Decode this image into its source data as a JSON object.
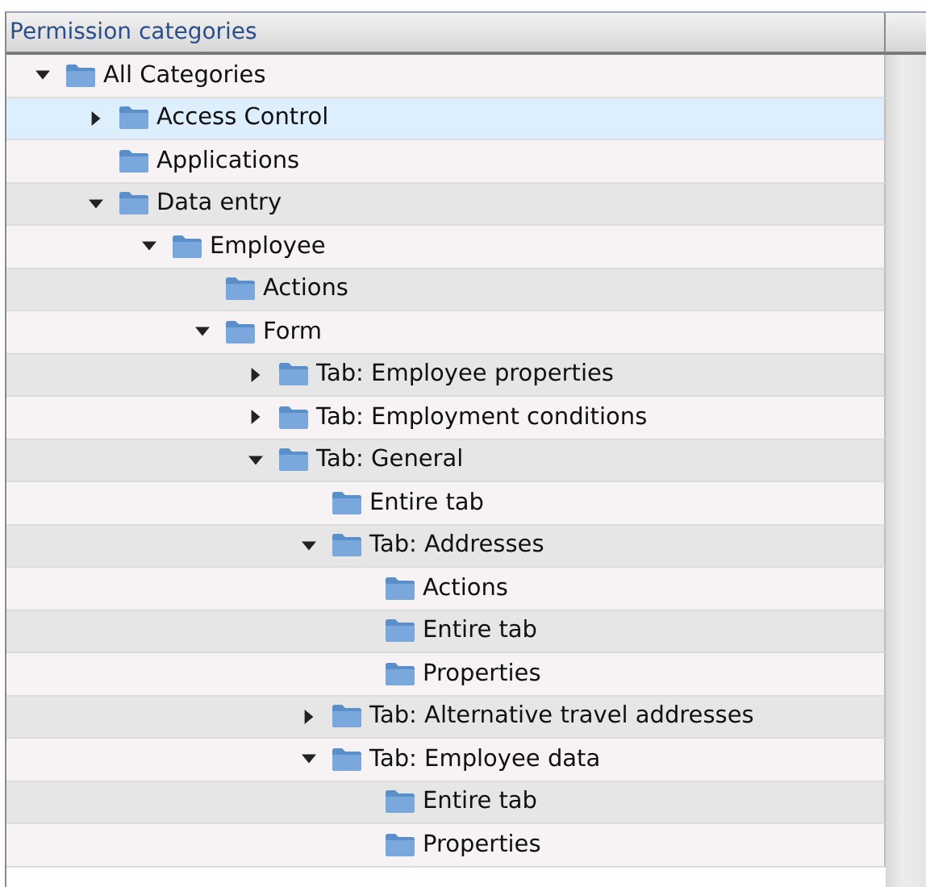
{
  "table": {
    "columns": [
      {
        "label": "Permission categories"
      }
    ],
    "tree": [
      {
        "label": "All Categories",
        "expanded": true,
        "selected": false,
        "children": [
          {
            "label": "Access Control",
            "expanded": false,
            "selected": true
          },
          {
            "label": "Applications",
            "selected": false
          },
          {
            "label": "Data entry",
            "expanded": true,
            "selected": false,
            "children": [
              {
                "label": "Employee",
                "expanded": true,
                "selected": false,
                "children": [
                  {
                    "label": "Actions",
                    "selected": false
                  },
                  {
                    "label": "Form",
                    "expanded": true,
                    "selected": false,
                    "children": [
                      {
                        "label": "Tab: Employee properties",
                        "expanded": false,
                        "selected": false
                      },
                      {
                        "label": "Tab: Employment conditions",
                        "expanded": false,
                        "selected": false
                      },
                      {
                        "label": "Tab: General",
                        "expanded": true,
                        "selected": false,
                        "children": [
                          {
                            "label": "Entire tab",
                            "selected": false
                          },
                          {
                            "label": "Tab: Addresses",
                            "expanded": true,
                            "selected": false,
                            "children": [
                              {
                                "label": "Actions",
                                "selected": false
                              },
                              {
                                "label": "Entire tab",
                                "selected": false
                              },
                              {
                                "label": "Properties",
                                "selected": false
                              }
                            ]
                          },
                          {
                            "label": "Tab: Alternative travel addresses",
                            "expanded": false,
                            "selected": false
                          },
                          {
                            "label": "Tab: Employee data",
                            "expanded": true,
                            "selected": false,
                            "children": [
                              {
                                "label": "Entire tab",
                                "selected": false
                              },
                              {
                                "label": "Properties",
                                "selected": false
                              }
                            ]
                          }
                        ]
                      }
                    ]
                  }
                ]
              }
            ]
          }
        ]
      }
    ]
  }
}
